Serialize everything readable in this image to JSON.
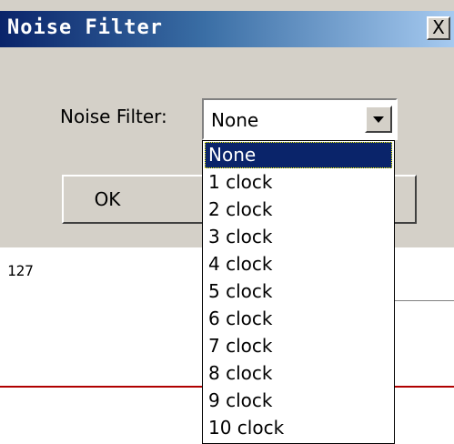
{
  "dialog": {
    "title": "Noise Filter",
    "close_label": "X",
    "field_label": "Noise Filter:",
    "combo_value": "None",
    "ok_label": "OK",
    "other_label": ""
  },
  "background": {
    "number": "127"
  },
  "dropdown": {
    "options": [
      {
        "label": "None",
        "selected": true
      },
      {
        "label": "1 clock"
      },
      {
        "label": "2 clock"
      },
      {
        "label": "3 clock"
      },
      {
        "label": "4 clock"
      },
      {
        "label": "5 clock"
      },
      {
        "label": "6 clock"
      },
      {
        "label": "7 clock"
      },
      {
        "label": "8 clock"
      },
      {
        "label": "9 clock"
      },
      {
        "label": "10 clock"
      }
    ]
  },
  "colors": {
    "titlebar_start": "#0a246a",
    "titlebar_end": "#a6caf0",
    "selection": "#0a246a",
    "dialog_bg": "#d4d0c8"
  }
}
